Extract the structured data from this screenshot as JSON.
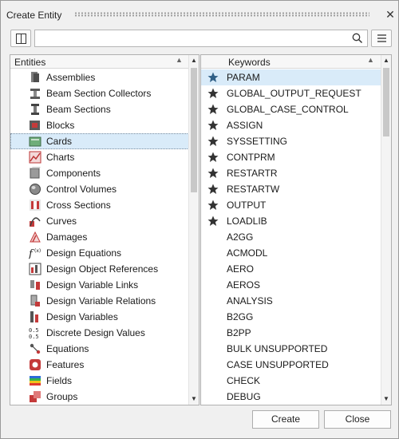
{
  "window": {
    "title": "Create Entity",
    "close_glyph": "✕"
  },
  "toolbar": {
    "panel_icon": "panel-layout-icon",
    "search": {
      "value": "",
      "placeholder": ""
    },
    "search_icon": "search-icon",
    "menu_icon": "hamburger-menu-icon"
  },
  "entities": {
    "header": "Entities",
    "items": [
      {
        "label": "Assemblies",
        "icon": "assemblies-icon"
      },
      {
        "label": "Beam Section Collectors",
        "icon": "beam-section-collectors-icon"
      },
      {
        "label": "Beam Sections",
        "icon": "beam-sections-icon"
      },
      {
        "label": "Blocks",
        "icon": "blocks-icon"
      },
      {
        "label": "Cards",
        "icon": "cards-icon",
        "selected": true
      },
      {
        "label": "Charts",
        "icon": "charts-icon"
      },
      {
        "label": "Components",
        "icon": "components-icon"
      },
      {
        "label": "Control Volumes",
        "icon": "control-volumes-icon"
      },
      {
        "label": "Cross Sections",
        "icon": "cross-sections-icon"
      },
      {
        "label": "Curves",
        "icon": "curves-icon"
      },
      {
        "label": "Damages",
        "icon": "damages-icon"
      },
      {
        "label": "Design Equations",
        "icon": "design-equations-icon"
      },
      {
        "label": "Design Object References",
        "icon": "design-object-references-icon"
      },
      {
        "label": "Design Variable Links",
        "icon": "design-variable-links-icon"
      },
      {
        "label": "Design Variable Relations",
        "icon": "design-variable-relations-icon"
      },
      {
        "label": "Design Variables",
        "icon": "design-variables-icon"
      },
      {
        "label": "Discrete Design Values",
        "icon": "discrete-design-values-icon"
      },
      {
        "label": "Equations",
        "icon": "equations-icon"
      },
      {
        "label": "Features",
        "icon": "features-icon"
      },
      {
        "label": "Fields",
        "icon": "fields-icon"
      },
      {
        "label": "Groups",
        "icon": "groups-icon"
      }
    ]
  },
  "keywords": {
    "header": "Keywords",
    "items": [
      {
        "label": "PARAM",
        "starred": true,
        "selected": true
      },
      {
        "label": "GLOBAL_OUTPUT_REQUEST",
        "starred": true
      },
      {
        "label": "GLOBAL_CASE_CONTROL",
        "starred": true
      },
      {
        "label": "ASSIGN",
        "starred": true
      },
      {
        "label": "SYSSETTING",
        "starred": true
      },
      {
        "label": "CONTPRM",
        "starred": true
      },
      {
        "label": "RESTARTR",
        "starred": true
      },
      {
        "label": "RESTARTW",
        "starred": true
      },
      {
        "label": "OUTPUT",
        "starred": true
      },
      {
        "label": "LOADLIB",
        "starred": true
      },
      {
        "label": "A2GG",
        "starred": false
      },
      {
        "label": "ACMODL",
        "starred": false
      },
      {
        "label": "AERO",
        "starred": false
      },
      {
        "label": "AEROS",
        "starred": false
      },
      {
        "label": "ANALYSIS",
        "starred": false
      },
      {
        "label": "B2GG",
        "starred": false
      },
      {
        "label": "B2PP",
        "starred": false
      },
      {
        "label": "BULK UNSUPPORTED",
        "starred": false
      },
      {
        "label": "CASE UNSUPPORTED",
        "starred": false
      },
      {
        "label": "CHECK",
        "starred": false
      },
      {
        "label": "DEBUG",
        "starred": false
      }
    ]
  },
  "footer": {
    "create_label": "Create",
    "close_label": "Close"
  },
  "colors": {
    "selection": "#d9ebf9",
    "star_selected": "#2f5f86",
    "star": "#333333"
  }
}
